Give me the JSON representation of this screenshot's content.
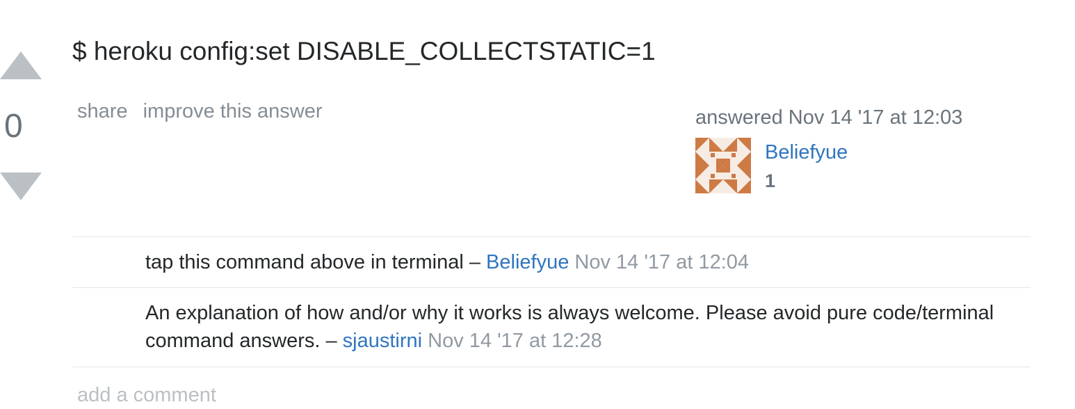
{
  "vote": {
    "count": "0",
    "up_icon": "arrow-up-icon",
    "down_icon": "arrow-down-icon"
  },
  "answer": {
    "code": "$ heroku config:set DISABLE_COLLECTSTATIC=1"
  },
  "post_menu": {
    "share": "share",
    "improve": "improve this answer"
  },
  "user_info": {
    "action_time": "answered Nov 14 '17 at 12:03",
    "user_name": "Beliefyue",
    "reputation": "1",
    "avatar_color": "#c8733e"
  },
  "comments": [
    {
      "text": "tap this command above in terminal – ",
      "user": "Beliefyue",
      "date": "Nov 14 '17 at 12:04"
    },
    {
      "text": "An explanation of how and/or why it works is always welcome. Please avoid pure code/terminal command answers. – ",
      "user": "sjaustirni",
      "date": "Nov 14 '17 at 12:28"
    }
  ],
  "add_comment": "add a comment"
}
